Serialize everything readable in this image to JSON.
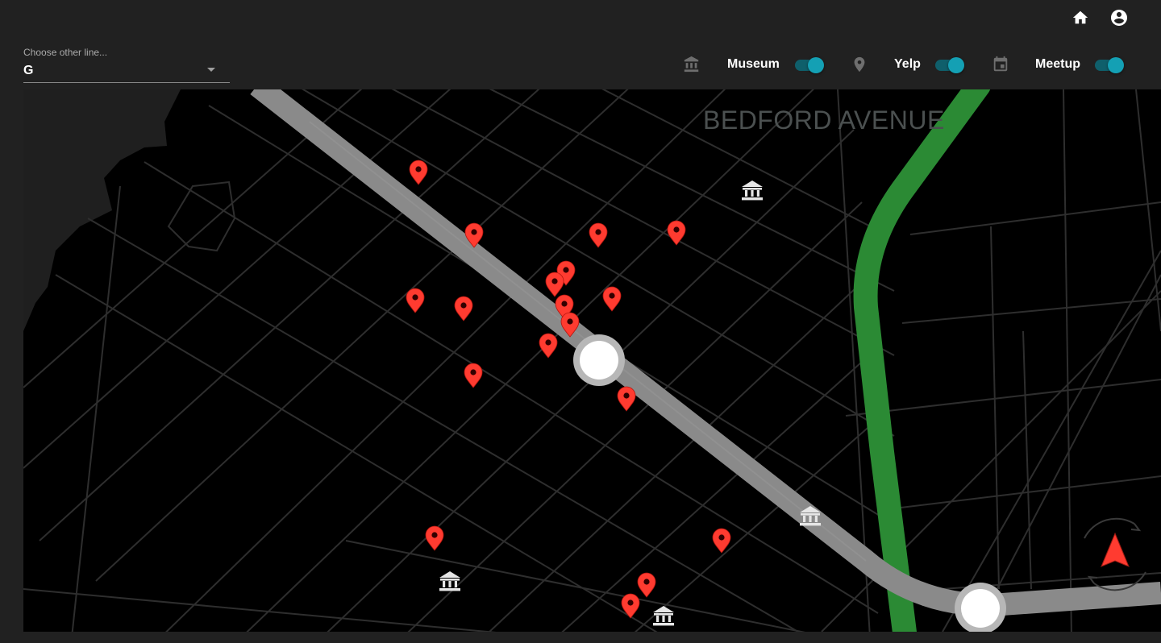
{
  "header": {
    "home_icon": "home-icon",
    "account_icon": "account-circle-icon"
  },
  "line_select": {
    "label": "Choose other line...",
    "value": "G"
  },
  "filters": [
    {
      "icon": "museum-icon",
      "label": "Museum",
      "enabled": true
    },
    {
      "icon": "location-pin-icon",
      "label": "Yelp",
      "enabled": true
    },
    {
      "icon": "calendar-icon",
      "label": "Meetup",
      "enabled": true
    }
  ],
  "map": {
    "station_label": "BEDFORD AVENUE",
    "colors": {
      "background": "#000000",
      "streets": "#2e2e2e",
      "land_mass": "#1f1f1f",
      "g_line": "#8a8a8a",
      "l_line": "#2b8a34",
      "marker": "#ff3b30",
      "museum": "#e0e0e0",
      "toggle_accent": "#14a0b4"
    },
    "compass_icon": "compass-navigation-icon"
  }
}
